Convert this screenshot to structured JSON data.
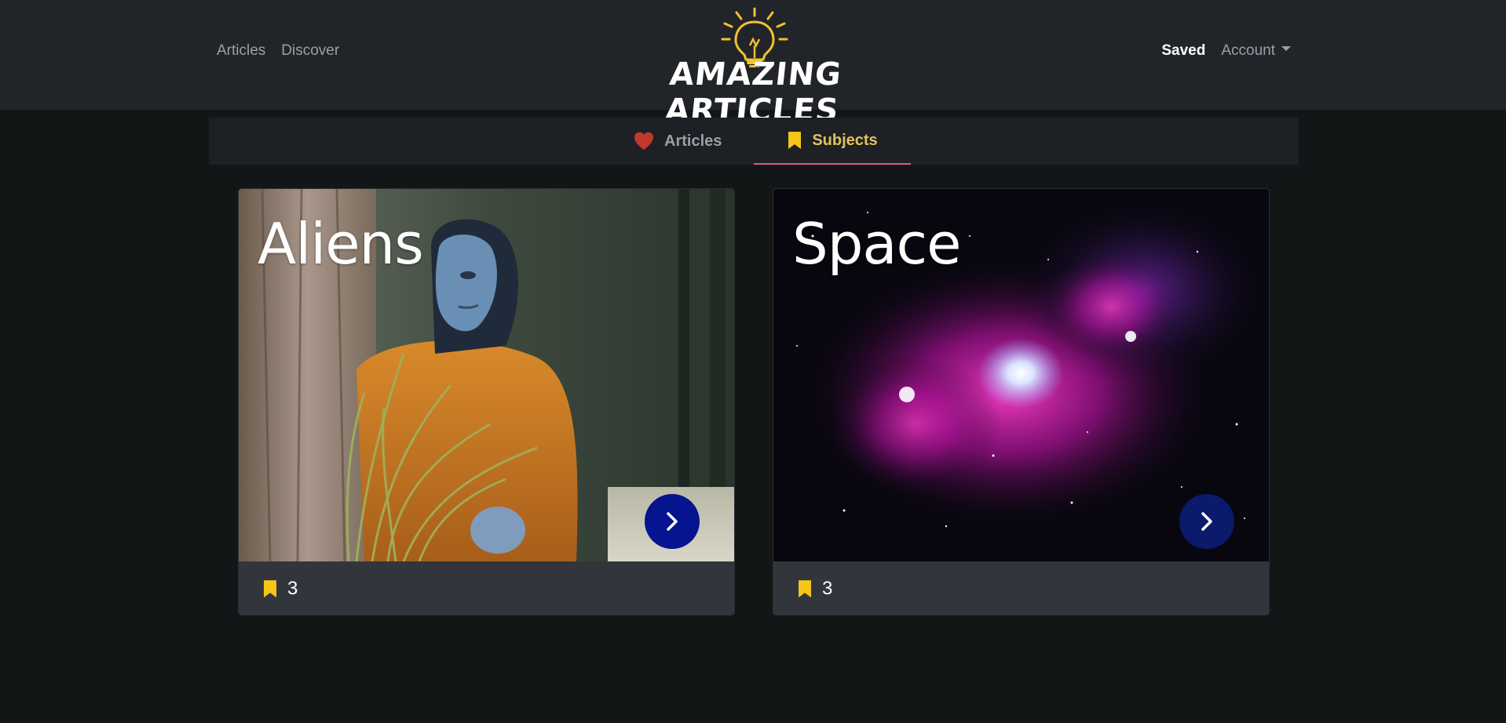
{
  "nav": {
    "left_links": [
      "Articles",
      "Discover"
    ],
    "saved": "Saved",
    "account": "Account"
  },
  "brand": {
    "name": "AMAZING ARTICLES",
    "logo_icon": "lightbulb-icon",
    "accent_color": "#f2c12e"
  },
  "subnav": {
    "tabs": [
      {
        "label": "Articles",
        "icon": "heart-icon",
        "icon_color": "#c0392b",
        "active": false
      },
      {
        "label": "Subjects",
        "icon": "bookmark-icon",
        "icon_color": "#f5c518",
        "active": true
      }
    ],
    "active_underline_color": "#e0568e"
  },
  "cards": [
    {
      "title": "Aliens",
      "count": "3",
      "icon": "bookmark-icon",
      "button_icon": "chevron-right-icon"
    },
    {
      "title": "Space",
      "count": "3",
      "icon": "bookmark-icon",
      "button_icon": "chevron-right-icon"
    }
  ]
}
